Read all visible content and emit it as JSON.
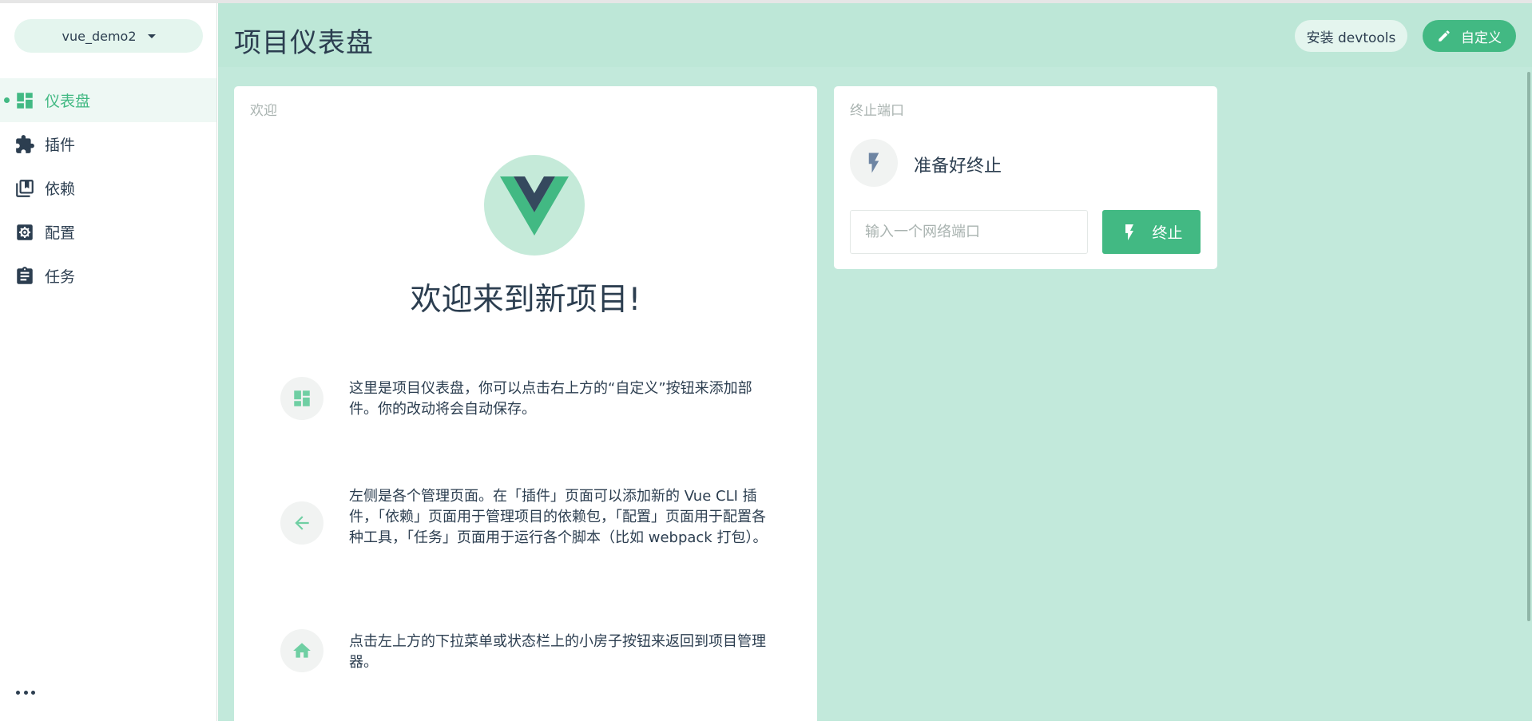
{
  "sidebar": {
    "project_name": "vue_demo2",
    "items": [
      {
        "label": "仪表盘",
        "icon": "dashboard-icon",
        "active": true
      },
      {
        "label": "插件",
        "icon": "puzzle-icon",
        "active": false
      },
      {
        "label": "依赖",
        "icon": "library-books-icon",
        "active": false
      },
      {
        "label": "配置",
        "icon": "settings-box-icon",
        "active": false
      },
      {
        "label": "任务",
        "icon": "clipboard-icon",
        "active": false
      }
    ],
    "more_icon": "more-horiz-icon"
  },
  "header": {
    "title": "项目仪表盘",
    "devtools_label": "安装 devtools",
    "customize_label": "自定义"
  },
  "welcome": {
    "card_title": "欢迎",
    "heading": "欢迎来到新项目!",
    "tips": [
      {
        "icon": "dashboard-icon",
        "text": "这里是项目仪表盘，你可以点击右上方的“自定义”按钮来添加部件。你的改动将会自动保存。"
      },
      {
        "icon": "arrow-back-icon",
        "text": "左侧是各个管理页面。在「插件」页面可以添加新的 Vue CLI 插件，「依赖」页面用于管理项目的依赖包，「配置」页面用于配置各种工具，「任务」页面用于运行各个脚本（比如 webpack 打包）。"
      },
      {
        "icon": "home-icon",
        "text": "点击左上方的下拉菜单或状态栏上的小房子按钮来返回到项目管理器。"
      }
    ]
  },
  "kill_port": {
    "card_title": "终止端口",
    "status": "准备好终止",
    "input_placeholder": "输入一个网络端口",
    "input_value": "",
    "kill_label": "终止"
  },
  "colors": {
    "accent": "#42b983",
    "main_background": "#c2e9db",
    "text": "#2c3e50",
    "muted": "#a9b3b0"
  }
}
